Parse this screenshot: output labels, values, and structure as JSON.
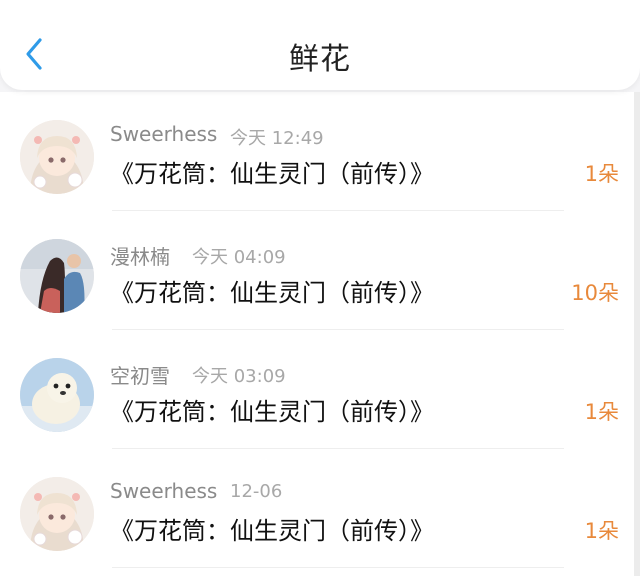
{
  "header": {
    "title": "鲜花",
    "back_icon": "chevron-left-icon",
    "accent_color": "#2f9be8"
  },
  "items": [
    {
      "user": "Sweerhess",
      "time": "今天 12:49",
      "book": "《万花筒：仙生灵门（前传）》",
      "count": "1朵",
      "avatar": "anime-girl-avatar"
    },
    {
      "user": "漫林楠",
      "time": "今天 04:09",
      "book": "《万花筒：仙生灵门（前传）》",
      "count": "10朵",
      "avatar": "couple-photo-avatar"
    },
    {
      "user": "空初雪",
      "time": "今天 03:09",
      "book": "《万花筒：仙生灵门（前传）》",
      "count": "1朵",
      "avatar": "seal-avatar"
    },
    {
      "user": "Sweerhess",
      "time": "12-06",
      "book": "《万花筒：仙生灵门（前传）》",
      "count": "1朵",
      "avatar": "anime-girl-avatar"
    }
  ],
  "colors": {
    "count": "#e8893b",
    "name": "#8a8a8a",
    "time": "#a8a8a8"
  }
}
